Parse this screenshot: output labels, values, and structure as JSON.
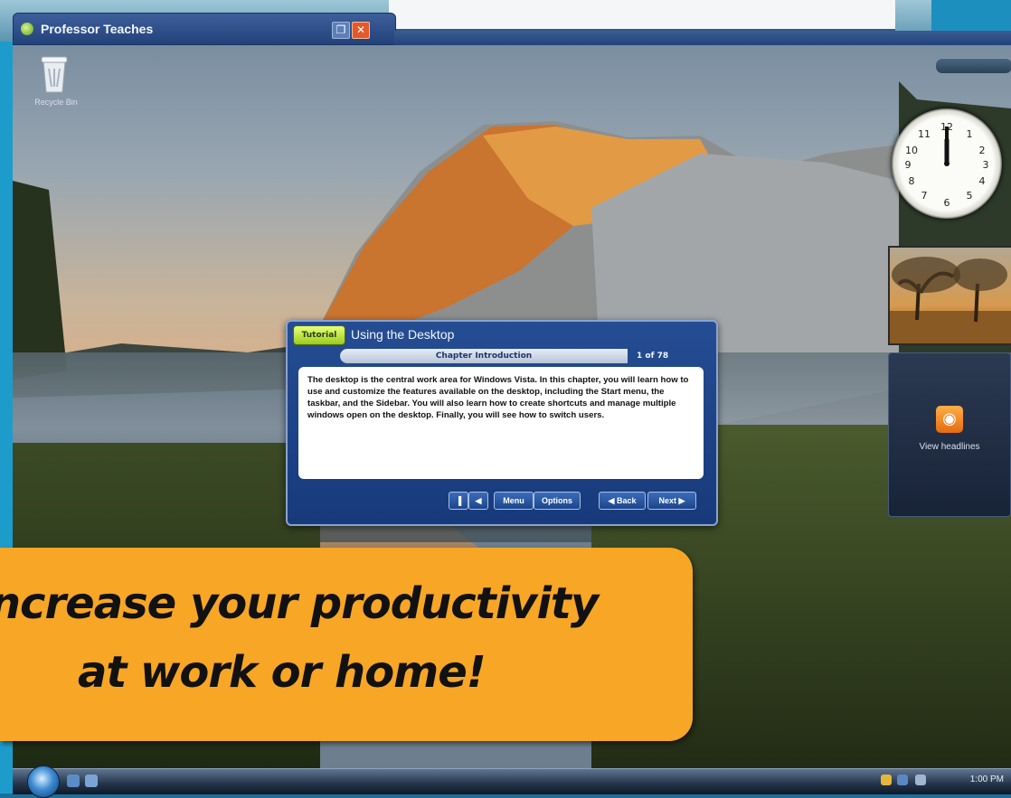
{
  "window": {
    "title": "Professor Teaches"
  },
  "desktop": {
    "recycle_bin_label": "Recycle Bin"
  },
  "sidebar": {
    "feed_label": "View headlines"
  },
  "lesson": {
    "logo": "Tutorial",
    "title": "Using the Desktop",
    "section": "Chapter Introduction",
    "page": "1 of 78",
    "body": "The desktop is the central work area for Windows Vista. In this chapter, you will learn how to use and customize the features available on the desktop, including the Start menu, the taskbar, and the Sidebar. You will also learn how to create shortcuts and manage multiple windows open on the desktop. Finally, you will see how to switch users.",
    "buttons": {
      "menu": "Menu",
      "options": "Options",
      "back": "◀ Back",
      "next": "Next ▶"
    }
  },
  "promo": {
    "line1": "Increase your productivity",
    "line2": "at work or home!"
  },
  "taskbar": {
    "time": "1:00 PM"
  },
  "colors": {
    "promo": "#f7a625",
    "title_bar": "#23427a"
  },
  "icons": [
    "recycle-bin-icon",
    "rss-icon",
    "start-orb-icon",
    "clock-gadget",
    "close-icon",
    "restore-icon"
  ]
}
